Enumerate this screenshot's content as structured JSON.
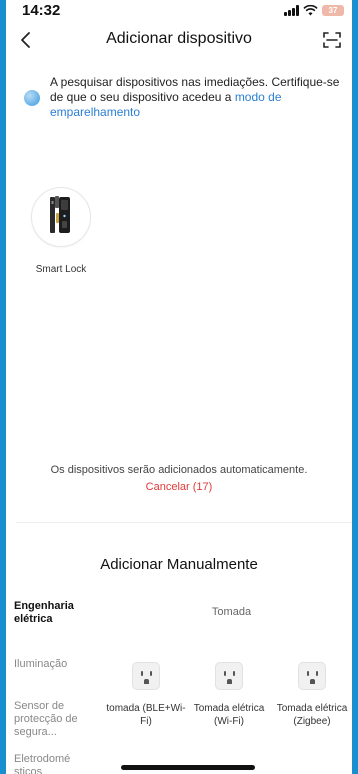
{
  "status_bar": {
    "time": "14:32",
    "battery": "37"
  },
  "header": {
    "title": "Adicionar dispositivo"
  },
  "search_notice": {
    "text": "A pesquisar dispositivos nas imediações. Certifique-se de que o seu dispositivo acedeu a ",
    "link": "modo de emparelhamento"
  },
  "found_devices": [
    {
      "name": "Smart Lock"
    }
  ],
  "auto_add": {
    "message": "Os dispositivos serão adicionados automaticamente.",
    "cancel": "Cancelar (17)"
  },
  "manual": {
    "title": "Adicionar Manualmente",
    "categories": [
      "Engenharia elétrica",
      "Iluminação",
      "Sensor de protecção de segura...",
      "Eletrodomé sticos"
    ],
    "active_category": "Engenharia elétrica",
    "section_title": "Tomada",
    "items": [
      {
        "label": "tomada (BLE+Wi-Fi)"
      },
      {
        "label": "Tomada elétrica (Wi-Fi)"
      },
      {
        "label": "Tomada elétrica (Zigbee)"
      }
    ]
  },
  "icons": {
    "back": "chevron-left-icon",
    "scan": "scan-icon",
    "search_indicator": "searching-dot-icon",
    "device": "smart-lock-icon",
    "outlet": "power-outlet-icon"
  },
  "colors": {
    "link": "#2a7fd4",
    "cancel": "#e03a3a",
    "frame": "#1a8fd0"
  }
}
